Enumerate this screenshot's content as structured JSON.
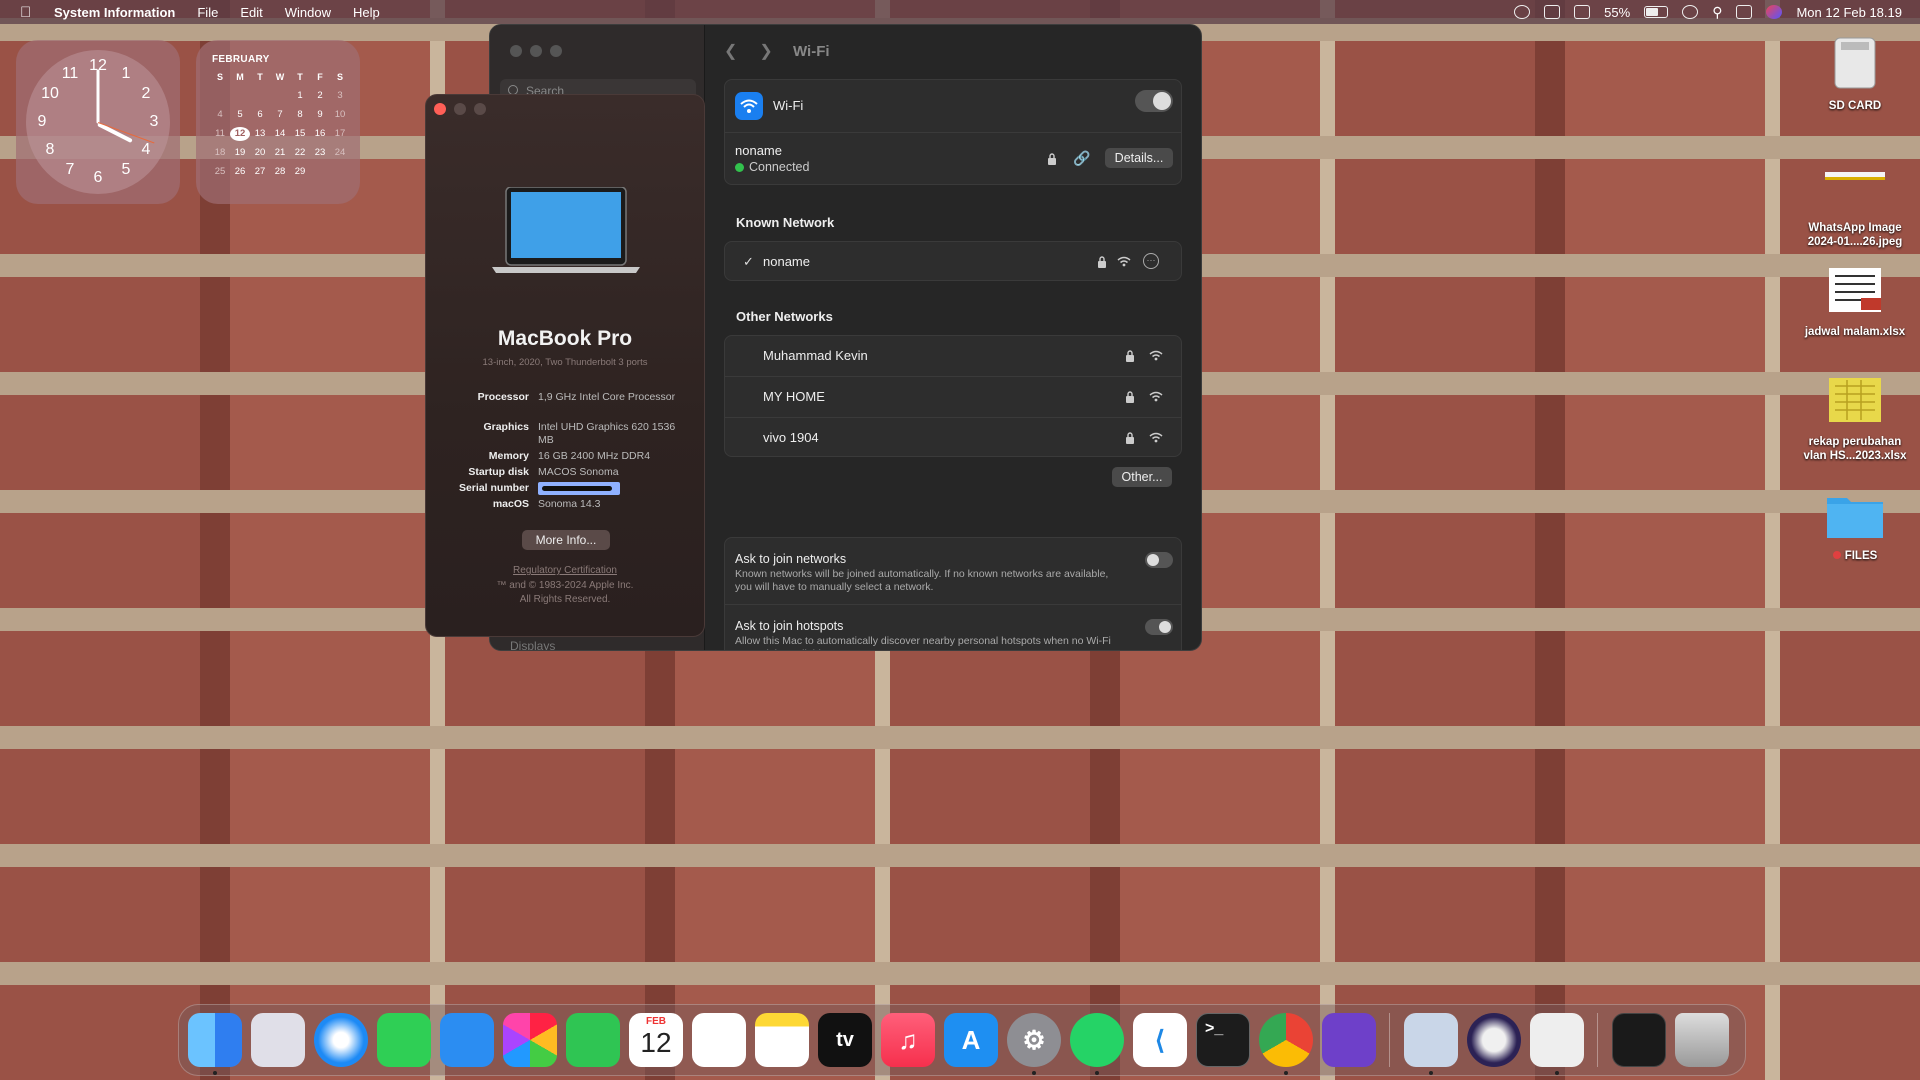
{
  "menubar": {
    "app_name": "System Information",
    "menus": [
      "File",
      "Edit",
      "Window",
      "Help"
    ],
    "battery_percent": "55%",
    "datetime": "Mon 12 Feb  18.19"
  },
  "widgets": {
    "clock_numbers": [
      "12",
      "1",
      "2",
      "3",
      "4",
      "5",
      "6",
      "7",
      "8",
      "9",
      "10",
      "11"
    ],
    "calendar": {
      "month": "FEBRUARY",
      "weekdays": [
        "S",
        "M",
        "T",
        "W",
        "T",
        "F",
        "S"
      ],
      "weeks": [
        [
          "",
          "",
          "",
          "",
          "1",
          "2",
          "3"
        ],
        [
          "4",
          "5",
          "6",
          "7",
          "8",
          "9",
          "10"
        ],
        [
          "11",
          "12",
          "13",
          "14",
          "15",
          "16",
          "17"
        ],
        [
          "18",
          "19",
          "20",
          "21",
          "22",
          "23",
          "24"
        ],
        [
          "25",
          "26",
          "27",
          "28",
          "29",
          "",
          ""
        ]
      ],
      "today": "12"
    }
  },
  "settings": {
    "search_placeholder": "Search",
    "sidebar_hint": "Displays",
    "title": "Wi-Fi",
    "wifi_label": "Wi-Fi",
    "wifi_enabled": true,
    "current_network": "noname",
    "current_status": "Connected",
    "details_button": "Details...",
    "known_title": "Known Network",
    "known_networks": [
      "noname"
    ],
    "other_title": "Other Networks",
    "other_networks": [
      "Muhammad Kevin",
      "MY HOME",
      "vivo 1904"
    ],
    "other_button": "Other...",
    "ask_networks": {
      "title": "Ask to join networks",
      "desc": "Known networks will be joined automatically. If no known networks are available, you will have to manually select a network.",
      "enabled": false
    },
    "ask_hotspots": {
      "title": "Ask to join hotspots",
      "desc": "Allow this Mac to automatically discover nearby personal hotspots when no Wi-Fi network is available.",
      "enabled": true
    }
  },
  "about": {
    "model": "MacBook Pro",
    "subtitle": "13-inch, 2020, Two Thunderbolt 3 ports",
    "specs": [
      {
        "key": "Processor",
        "value": "1,9 GHz Intel Core Processor"
      },
      {
        "key": "Graphics",
        "value": "Intel UHD Graphics 620 1536 MB"
      },
      {
        "key": "Memory",
        "value": "16 GB 2400 MHz DDR4"
      },
      {
        "key": "Startup disk",
        "value": "MACOS Sonoma"
      },
      {
        "key": "Serial number",
        "value": ""
      },
      {
        "key": "macOS",
        "value": "Sonoma 14.3"
      }
    ],
    "more_info_button": "More Info...",
    "regulatory_link": "Regulatory Certification",
    "copyright": "™ and © 1983-2024 Apple Inc.",
    "rights": "All Rights Reserved."
  },
  "desktop_items": [
    {
      "label": "SD CARD"
    },
    {
      "label": "WhatsApp Image 2024-01....26.jpeg"
    },
    {
      "label": "jadwal malam.xlsx"
    },
    {
      "label": "rekap perubahan vlan HS...2023.xlsx"
    },
    {
      "label": "FILES"
    }
  ],
  "dock": {
    "apps": [
      "Finder",
      "Launchpad",
      "Safari",
      "Messages",
      "Mail",
      "Photos",
      "FaceTime",
      "Calendar",
      "Reminders",
      "Notes",
      "TV",
      "Music",
      "App Store",
      "System Settings",
      "WhatsApp",
      "Visual Studio Code",
      "Terminal",
      "Google Chrome",
      "GitHub Desktop",
      "System Information",
      "Eclipse",
      "Network Utility",
      "Activity Monitor",
      "Trash"
    ],
    "calendar_month": "FEB",
    "calendar_day": "12",
    "tv_label": "tv"
  }
}
